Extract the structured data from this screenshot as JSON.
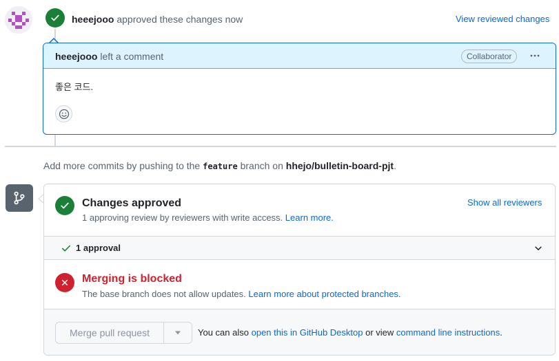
{
  "review_event": {
    "author": "heeejooo",
    "action_text": "approved these changes now",
    "view_reviewed_link": "View reviewed changes"
  },
  "comment": {
    "author": "heeejooo",
    "action_text": "left a comment",
    "role_label": "Collaborator",
    "body": "좋은 코드."
  },
  "commit_hint": {
    "prefix": "Add more commits by pushing to the",
    "branch": "feature",
    "middle": "branch on",
    "repo": "hhejo/bulletin-board-pjt",
    "suffix": "."
  },
  "merge_box": {
    "approved": {
      "title": "Changes approved",
      "description": "1 approving review by reviewers with write access.",
      "learn_more": "Learn more.",
      "show_reviewers": "Show all reviewers"
    },
    "approval_row": {
      "label": "1 approval"
    },
    "blocked": {
      "title": "Merging is blocked",
      "description": "The base branch does not allow updates.",
      "learn_more": "Learn more about protected branches."
    },
    "merge": {
      "button_label": "Merge pull request",
      "alt_prefix": "You can also",
      "desktop_link": "open this in GitHub Desktop",
      "alt_middle": "or view",
      "cli_link": "command line instructions",
      "alt_suffix": "."
    }
  },
  "colors": {
    "success": "#1a7f37",
    "danger": "#cf222e",
    "accent": "#0969da",
    "avatar": "#b44ec4"
  },
  "icons": [
    "identicon-avatar",
    "check-icon",
    "kebab-icon",
    "smiley-icon",
    "git-branch-icon",
    "x-icon",
    "chevron-down-icon",
    "triangle-down-icon"
  ]
}
